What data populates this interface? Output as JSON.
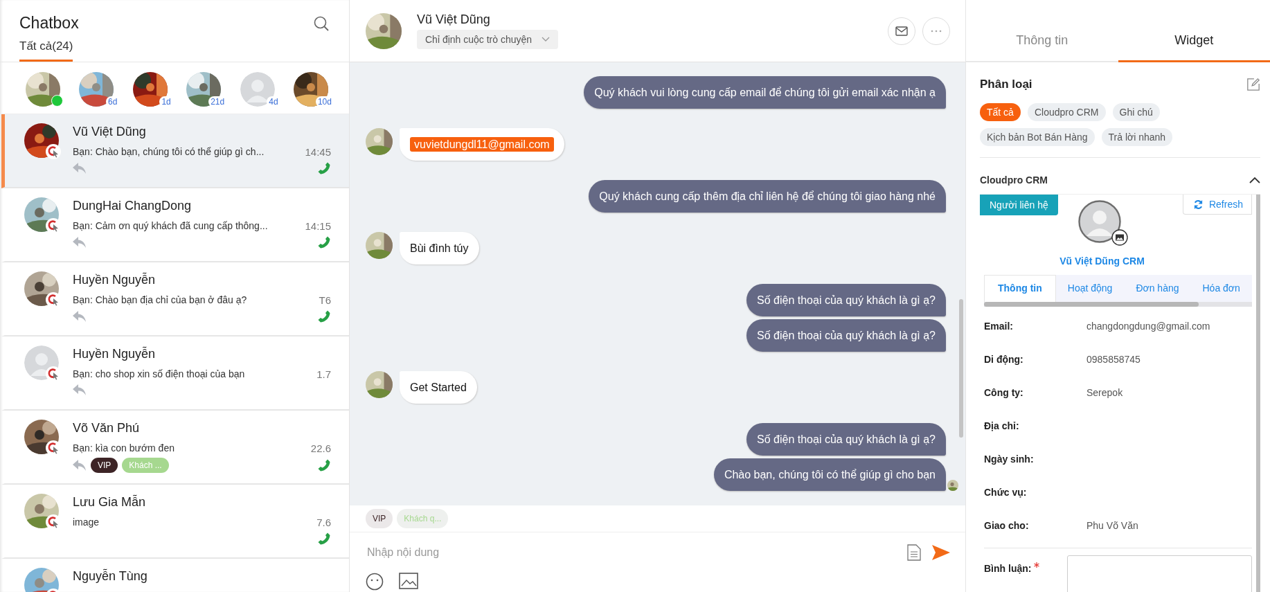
{
  "sidebar": {
    "title": "Chatbox",
    "tabs": [
      {
        "label": "Tất cả(24)",
        "selected": true
      }
    ],
    "stories": [
      {
        "online": true,
        "photo": true
      },
      {
        "badge": "6d",
        "online": false,
        "photo": true
      },
      {
        "badge": "1d",
        "online": false,
        "photo": true
      },
      {
        "badge": "21d",
        "online": false,
        "photo": true
      },
      {
        "badge": "4d",
        "online": false,
        "photo": false
      },
      {
        "badge": "10d",
        "online": false,
        "photo": true
      }
    ],
    "conversations": [
      {
        "name": "Vũ Việt Dũng",
        "preview": "Bạn: Chào bạn, chúng tôi có thể giúp gì ch...",
        "time": "14:45",
        "selected": true,
        "replied": true,
        "call": true,
        "photo": true
      },
      {
        "name": "DungHai ChangDong",
        "preview": "Bạn: Cảm ơn quý khách đã cung cấp thông...",
        "time": "14:15",
        "selected": false,
        "replied": true,
        "call": true,
        "photo": true
      },
      {
        "name": "Huyền Nguyễn",
        "preview": "Bạn: Chào bạn địa chỉ của bạn ở đâu ạ?",
        "time": "T6",
        "selected": false,
        "replied": true,
        "call": true,
        "photo": true
      },
      {
        "name": "Huyền Nguyễn",
        "preview": "Bạn: cho shop xin số điện thoại của bạn",
        "time": "1.7",
        "selected": false,
        "replied": true,
        "call": false,
        "photo": false
      },
      {
        "name": "Võ Văn Phú",
        "preview": "Bạn: kìa con bướm đen",
        "time": "22.6",
        "selected": false,
        "replied": true,
        "call": true,
        "photo": true,
        "tags": [
          {
            "label": "VIP",
            "color": "#3d2426"
          },
          {
            "label": "Khách ...",
            "color": "#a6d88f"
          }
        ]
      },
      {
        "name": "Lưu Gia Mẫn",
        "preview": "image",
        "time": "7.6",
        "selected": false,
        "replied": false,
        "call": true,
        "photo": true
      },
      {
        "name": "Nguyễn Tùng",
        "selected": false,
        "photo": true
      }
    ]
  },
  "chat": {
    "contact_name": "Vũ Việt Dũng",
    "assign": "Chỉ định cuộc trò chuyện",
    "messages": [
      {
        "kind": "sent",
        "text": "Quý khách vui lòng cung cấp email để chúng tôi gửi email xác nhận ạ",
        "seen": false
      },
      {
        "kind": "email",
        "text": "vuvietdungdl11@gmail.com",
        "seen": false
      },
      {
        "kind": "sent",
        "text": "Quý khách cung cấp thêm địa chỉ liên hệ để chúng tôi giao hàng nhé",
        "seen": false
      },
      {
        "kind": "received",
        "text": "Bùi đình túy",
        "seen": false
      },
      {
        "kind": "sent",
        "text": "Số điện thoại của quý khách là gì ạ?",
        "seen": false
      },
      {
        "kind": "sent",
        "text": "Số điện thoại của quý khách là gì ạ?",
        "seen": false
      },
      {
        "kind": "received",
        "text": "Get Started",
        "seen": false
      },
      {
        "kind": "sent",
        "text": "Số điện thoại của quý khách là gì ạ?",
        "seen": false
      },
      {
        "kind": "sent",
        "text": "Chào bạn, chúng tôi có thể giúp gì cho bạn",
        "seen": true
      }
    ],
    "tags": [
      {
        "label": "VIP",
        "color": "#3d2426"
      },
      {
        "label": "Khách q...",
        "color": "#a6d88f"
      }
    ],
    "input": {
      "placeholder": "Nhập nội dung"
    }
  },
  "panel": {
    "tabs": [
      {
        "label": "Thông tin",
        "selected": false
      },
      {
        "label": "Widget",
        "selected": true
      }
    ],
    "category_title": "Phân loại",
    "categories": [
      {
        "label": "Tất cả",
        "selected": true
      },
      {
        "label": "Cloudpro CRM",
        "selected": false
      },
      {
        "label": "Ghi chú",
        "selected": false
      },
      {
        "label": "Kịch bản Bot Bán Hàng",
        "selected": false
      },
      {
        "label": "Trả lời nhanh",
        "selected": false
      }
    ],
    "crm": {
      "title": "Cloudpro CRM",
      "expanded": true,
      "badge": "Người liên hệ",
      "refresh": "Refresh",
      "contact_name": "Vũ Việt Dũng CRM",
      "tabs": [
        {
          "label": "Thông tin",
          "selected": true
        },
        {
          "label": "Hoạt động",
          "selected": false
        },
        {
          "label": "Đơn hàng",
          "selected": false
        },
        {
          "label": "Hóa đơn",
          "selected": false
        }
      ],
      "fields": [
        {
          "label": "Email:",
          "value": "changdongdung@gmail.com"
        },
        {
          "label": "Di động:",
          "value": "0985858745"
        },
        {
          "label": "Công ty:",
          "value": "Serepok"
        },
        {
          "label": "Địa chỉ:"
        },
        {
          "label": "Ngày sinh:"
        },
        {
          "label": "Chức vụ:"
        },
        {
          "label": "Giao cho:",
          "value": "Phu Võ Văn"
        }
      ],
      "comment_label": "Bình luận:",
      "comment_required": true
    }
  }
}
